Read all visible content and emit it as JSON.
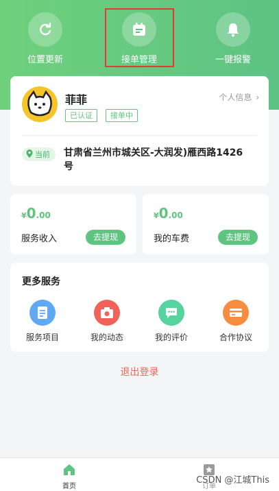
{
  "header": {
    "actions": [
      {
        "label": "位置更新",
        "icon": "refresh-icon"
      },
      {
        "label": "接单管理",
        "icon": "calendar-icon"
      },
      {
        "label": "一键报警",
        "icon": "bell-icon"
      }
    ]
  },
  "profile": {
    "name": "菲菲",
    "tags": [
      "已认证",
      "接单中"
    ],
    "info_link": "个人信息",
    "location_badge": "当前",
    "address": "甘肃省兰州市城关区-大润发)雁西路1426号"
  },
  "earnings": [
    {
      "currency": "¥",
      "amount_int": "0",
      "amount_dec": ".00",
      "label": "服务收入",
      "button": "去提现"
    },
    {
      "currency": "¥",
      "amount_int": "0",
      "amount_dec": ".00",
      "label": "我的车费",
      "button": "去提现"
    }
  ],
  "services": {
    "title": "更多服务",
    "items": [
      {
        "label": "服务项目",
        "icon": "document-icon",
        "color": "#5fa8f5"
      },
      {
        "label": "我的动态",
        "icon": "camera-icon",
        "color": "#f0625a"
      },
      {
        "label": "我的评价",
        "icon": "chat-icon",
        "color": "#57d3a0"
      },
      {
        "label": "合作协议",
        "icon": "card-icon",
        "color": "#f78c3f"
      }
    ]
  },
  "logout_label": "退出登录",
  "tabbar": {
    "tabs": [
      {
        "label": "首页",
        "icon": "home-icon",
        "active": true
      },
      {
        "label": "订单",
        "icon": "star-icon",
        "active": false
      }
    ]
  },
  "watermark": "CSDN @江城This",
  "colors": {
    "accent": "#5fc47f",
    "logout": "#e46a5a"
  }
}
